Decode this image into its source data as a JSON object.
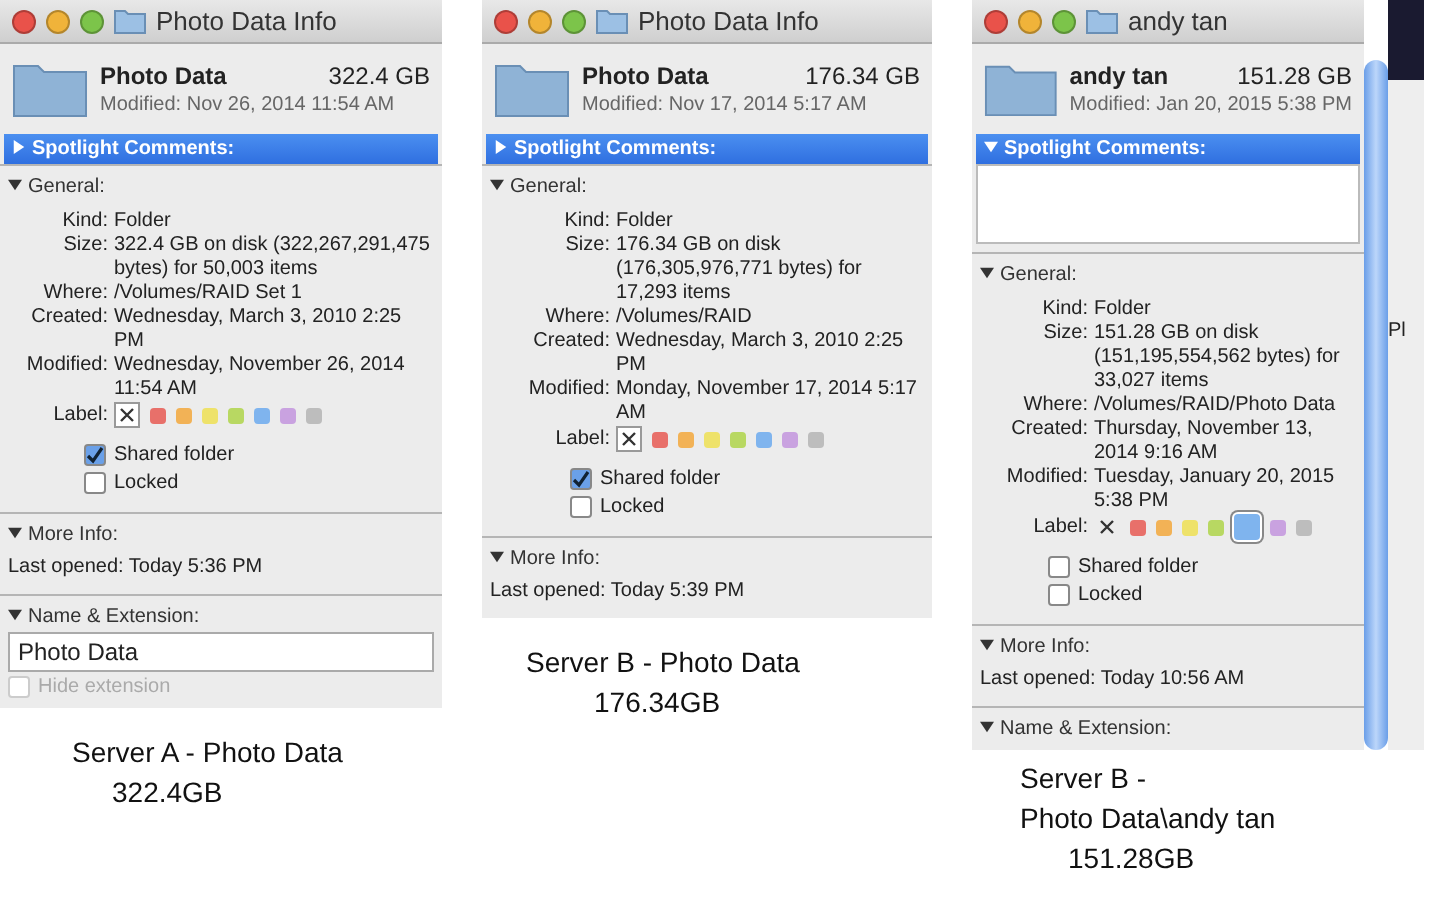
{
  "panels": [
    {
      "window_title": "Photo Data Info",
      "name": "Photo Data",
      "size": "322.4 GB",
      "modified": "Modified: Nov 26, 2014 11:54 AM",
      "spotlight": {
        "label": "Spotlight Comments:",
        "expanded": false
      },
      "general": {
        "label": "General:",
        "expanded": true,
        "rows": [
          {
            "key": "Kind:",
            "value": "Folder"
          },
          {
            "key": "Size:",
            "value": "322.4 GB on disk (322,267,291,475 bytes) for 50,003 items"
          },
          {
            "key": "Where:",
            "value": "/Volumes/RAID Set 1"
          },
          {
            "key": "Created:",
            "value": "Wednesday, March 3, 2010 2:25 PM"
          },
          {
            "key": "Modified:",
            "value": "Wednesday, November 26, 2014 11:54 AM"
          }
        ],
        "label_key": "Label:",
        "swatches": [
          {
            "kind": "none",
            "selected": true
          },
          {
            "kind": "color",
            "color": "#e8706a",
            "selected": false
          },
          {
            "kind": "color",
            "color": "#f2b256",
            "selected": false
          },
          {
            "kind": "color",
            "color": "#eee26a",
            "selected": false
          },
          {
            "kind": "color",
            "color": "#b8d862",
            "selected": false
          },
          {
            "kind": "color",
            "color": "#7fb4ee",
            "selected": false
          },
          {
            "kind": "color",
            "color": "#c9a2e0",
            "selected": false
          },
          {
            "kind": "color",
            "color": "#bdbdbd",
            "selected": false
          }
        ]
      },
      "checkboxes": [
        {
          "label": "Shared folder",
          "checked": true
        },
        {
          "label": "Locked",
          "checked": false
        }
      ],
      "more_info": {
        "label": "More Info:",
        "expanded": true,
        "last_opened": "Last opened: Today 5:36 PM"
      },
      "name_extension": {
        "label": "Name & Extension:",
        "expanded": true,
        "value": "Photo Data",
        "hide_extension": {
          "label": "Hide extension",
          "checked": false,
          "disabled": true
        }
      },
      "caption": [
        "Server A - Photo Data",
        "322.4GB"
      ]
    },
    {
      "window_title": "Photo Data Info",
      "name": "Photo Data",
      "size": "176.34 GB",
      "modified": "Modified: Nov 17, 2014 5:17 AM",
      "spotlight": {
        "label": "Spotlight Comments:",
        "expanded": false
      },
      "general": {
        "label": "General:",
        "expanded": true,
        "rows": [
          {
            "key": "Kind:",
            "value": "Folder"
          },
          {
            "key": "Size:",
            "value": "176.34 GB on disk (176,305,976,771 bytes) for 17,293 items"
          },
          {
            "key": "Where:",
            "value": "/Volumes/RAID"
          },
          {
            "key": "Created:",
            "value": "Wednesday, March 3, 2010 2:25 PM"
          },
          {
            "key": "Modified:",
            "value": "Monday, November 17, 2014 5:17 AM"
          }
        ],
        "label_key": "Label:",
        "swatches": [
          {
            "kind": "none",
            "selected": true
          },
          {
            "kind": "color",
            "color": "#e8706a",
            "selected": false
          },
          {
            "kind": "color",
            "color": "#f2b256",
            "selected": false
          },
          {
            "kind": "color",
            "color": "#eee26a",
            "selected": false
          },
          {
            "kind": "color",
            "color": "#b8d862",
            "selected": false
          },
          {
            "kind": "color",
            "color": "#7fb4ee",
            "selected": false
          },
          {
            "kind": "color",
            "color": "#c9a2e0",
            "selected": false
          },
          {
            "kind": "color",
            "color": "#bdbdbd",
            "selected": false
          }
        ]
      },
      "checkboxes": [
        {
          "label": "Shared folder",
          "checked": true
        },
        {
          "label": "Locked",
          "checked": false
        }
      ],
      "more_info": {
        "label": "More Info:",
        "expanded": true,
        "last_opened": "Last opened: Today 5:39 PM"
      },
      "caption": [
        "Server B - Photo Data",
        "176.34GB"
      ]
    },
    {
      "window_title": "andy tan",
      "name": "andy tan",
      "size": "151.28 GB",
      "modified": "Modified: Jan 20, 2015 5:38 PM",
      "spotlight": {
        "label": "Spotlight Comments:",
        "expanded": true
      },
      "general": {
        "label": "General:",
        "expanded": true,
        "rows": [
          {
            "key": "Kind:",
            "value": "Folder"
          },
          {
            "key": "Size:",
            "value": "151.28 GB on disk (151,195,554,562 bytes) for 33,027 items"
          },
          {
            "key": "Where:",
            "value": "/Volumes/RAID/Photo Data"
          },
          {
            "key": "Created:",
            "value": "Thursday, November 13, 2014 9:16 AM"
          },
          {
            "key": "Modified:",
            "value": "Tuesday, January 20, 2015 5:38 PM"
          }
        ],
        "label_key": "Label:",
        "swatches": [
          {
            "kind": "none",
            "selected": false
          },
          {
            "kind": "color",
            "color": "#e8706a",
            "selected": false
          },
          {
            "kind": "color",
            "color": "#f2b256",
            "selected": false
          },
          {
            "kind": "color",
            "color": "#eee26a",
            "selected": false
          },
          {
            "kind": "color",
            "color": "#b8d862",
            "selected": false
          },
          {
            "kind": "color",
            "color": "#7fb4ee",
            "selected": true
          },
          {
            "kind": "color",
            "color": "#c9a2e0",
            "selected": false
          },
          {
            "kind": "color",
            "color": "#bdbdbd",
            "selected": false
          }
        ]
      },
      "checkboxes": [
        {
          "label": "Shared folder",
          "checked": false
        },
        {
          "label": "Locked",
          "checked": false
        }
      ],
      "more_info": {
        "label": "More Info:",
        "expanded": true,
        "last_opened": "Last opened: Today 10:56 AM"
      },
      "name_extension": {
        "label": "Name & Extension:",
        "expanded": true
      },
      "side_fragment": "Pl",
      "caption": [
        "Server B -",
        "Photo Data\\andy tan",
        "151.28GB"
      ]
    }
  ]
}
